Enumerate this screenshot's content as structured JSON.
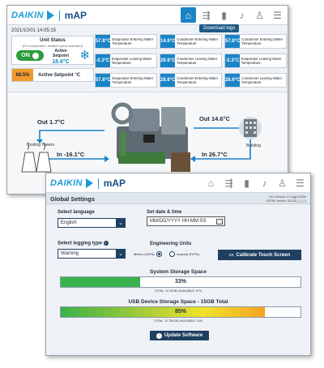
{
  "brand": {
    "name": "DAIKIN",
    "app": "mAP"
  },
  "nav_icons": [
    "home-icon",
    "usb-icon",
    "signal-icon",
    "alarm-icon",
    "operator-icon",
    "menu-icon"
  ],
  "main": {
    "datetime": "2021/10/01  14:05:15",
    "download_logs": "Download logs",
    "unit_status": {
      "title": "Unit Status",
      "subtitle": "(HI compartable, detailed panel activated)",
      "on_label": "ON",
      "setpoint_label": "Active Setpoint",
      "setpoint_value": "18.6°C"
    },
    "active_setpoint": {
      "percent": "88.5%",
      "label": "Active Setpoint °C"
    },
    "temps": [
      {
        "value": "57.8°C",
        "label": "Evaporator Entering Water Temperature"
      },
      {
        "value": "14.6°C",
        "label": "Condenser Entering Water Temperature"
      },
      {
        "value": "57.8°C",
        "label": "Condenser Entering Water Temperature"
      },
      {
        "value": "-2.3°C",
        "label": "Evaporator Leaving Water Temperature"
      },
      {
        "value": "28.6°C",
        "label": "Condenser Leaving Water Temperature"
      },
      {
        "value": "-2.3°C",
        "label": "Evaporator Leaving Water Temperature"
      },
      {
        "value": "57.8°C",
        "label": "Evaporator Entering Water Temperature"
      },
      {
        "value": "28.6°C",
        "label": "Condenser Entering Water Temperature"
      },
      {
        "value": "28.6°C",
        "label": "Condenser Leaving Water Temperature"
      }
    ],
    "diagram": {
      "out_left": "Out 1.7°C",
      "in_left": "In -16.1°C",
      "out_right": "Out 14.6°C",
      "in_right": "In 26.7°C",
      "cooling_towers": "Cooling Towers",
      "building": "Building"
    }
  },
  "settings": {
    "title": "Global Settings",
    "version_lines": [
      "GUI Version: V.3.0(g)12345c",
      "CNTRL Version: SCL53_1_2_3"
    ],
    "language_label": "Select language",
    "language_value": "English",
    "datetime_label": "Set date & time",
    "datetime_placeholder": "MM/DD/YYYY HH:MM:SS",
    "logging_label": "Select logging type",
    "logging_value": "Warning",
    "units_label": "Engineering Units",
    "metric_label": "Metric (C/kPa)",
    "imperial_label": "Imperial (F/PSI)",
    "calibrate_label": "Calibrate Touch Screen",
    "system_storage": {
      "title": "System Storage Space",
      "percent_text": "33%",
      "fill": 0.33,
      "caption": "TOTAL: 12.10GB | AVAILABLE: 67%"
    },
    "usb_storage": {
      "title": "USB Device Storage Space - 15GB Total",
      "percent_text": "85%",
      "fill": 0.85,
      "caption": "TOTAL: 12.750GB | AVAILABLE: 15%"
    },
    "update_label": "Update Software"
  },
  "colors": {
    "brand_blue": "#1a9ad6",
    "navy": "#1e3f60",
    "green": "#2a9d3a",
    "orange": "#ef9a2b"
  }
}
